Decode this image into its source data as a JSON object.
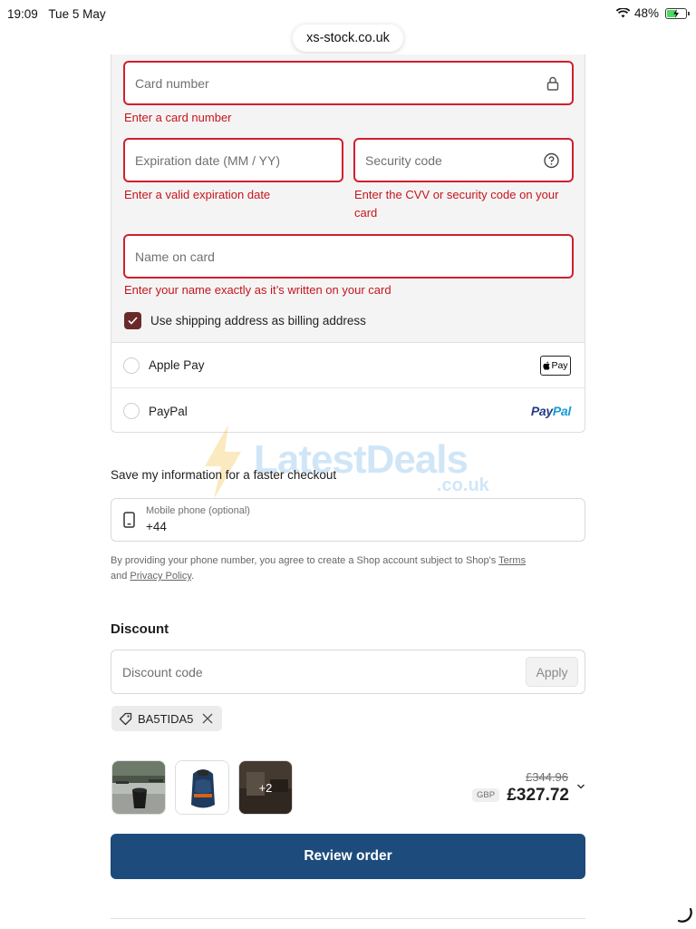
{
  "status_bar": {
    "time": "19:09",
    "date": "Tue 5 May",
    "battery": "48%"
  },
  "browser": {
    "url": "xs-stock.co.uk"
  },
  "card_form": {
    "card_number": {
      "placeholder": "Card number",
      "error": "Enter a card number"
    },
    "expiry": {
      "placeholder": "Expiration date (MM / YY)",
      "error": "Enter a valid expiration date"
    },
    "security": {
      "placeholder": "Security code",
      "error_line1": "Enter the CVV or security code on your",
      "error_line2": "card"
    },
    "name": {
      "placeholder": "Name on card",
      "error": "Enter your name exactly as it’s written on your card"
    },
    "billing_checkbox_label": "Use shipping address as billing address"
  },
  "payment_methods": [
    {
      "label": "Apple Pay",
      "badge": "Pay"
    },
    {
      "label": "PayPal",
      "logo_part1": "Pay",
      "logo_part2": "Pal"
    }
  ],
  "watermark": {
    "text": "LatestDeals",
    "sub": ".co.uk"
  },
  "save_info": {
    "title": "Save my information for a faster checkout",
    "phone_label": "Mobile phone (optional)",
    "phone_value": "+44",
    "consent_text": "By providing your phone number, you agree to create a Shop account subject to Shop's ",
    "terms_link": "Terms",
    "consent_and": "and ",
    "privacy_link": "Privacy Policy",
    "consent_end": "."
  },
  "discount": {
    "heading": "Discount",
    "placeholder": "Discount code",
    "apply_label": "Apply",
    "applied_code": "BA5TIDA5"
  },
  "order_summary": {
    "more_items": "+2",
    "original_price": "£344.96",
    "currency": "GBP",
    "total": "£327.72"
  },
  "actions": {
    "review_order": "Review order"
  }
}
